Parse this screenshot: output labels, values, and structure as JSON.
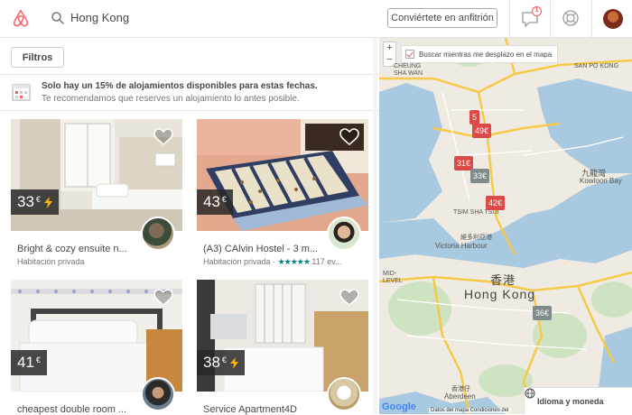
{
  "header": {
    "search_value": "Hong Kong",
    "host_button": "Conviértete en anfitrión",
    "message_badge": "1"
  },
  "filters": {
    "label": "Filtros"
  },
  "notice": {
    "title": "Solo hay un 15% de alojamientos disponibles para estas fechas.",
    "subtitle": "Te recomendamos que reserves un alojamiento lo antes posible."
  },
  "listings": [
    {
      "price": "33",
      "currency": "€",
      "instant": true,
      "title": "Bright & cozy ensuite n...",
      "subtitle": "Habitación privada",
      "rating": "",
      "reviews": ""
    },
    {
      "price": "43",
      "currency": "€",
      "instant": false,
      "title": "(A3) CAlvin Hostel - 3 m...",
      "subtitle": "Habitación privada ·",
      "rating": "★★★★★",
      "reviews": "117 ev..."
    },
    {
      "price": "41",
      "currency": "€",
      "instant": false,
      "title": "cheapest double room ...",
      "subtitle": "",
      "rating": "",
      "reviews": ""
    },
    {
      "price": "38",
      "currency": "€",
      "instant": true,
      "title": "Service Apartment4D",
      "subtitle": "",
      "rating": "",
      "reviews": ""
    }
  ],
  "map": {
    "search_while_moving": "Buscar mientras me desplazo en el mapa",
    "zoom_in": "+",
    "zoom_out": "−",
    "city_label": "Hong Kong",
    "city_label_cn": "香港",
    "places": {
      "cheung_sha_wan": "CHEUNG\nSHA WAN",
      "san_po_kong": "SAN PO KONG",
      "kowloon_bay_cn": "九龍灣",
      "kowloon_bay": "Kowloon Bay",
      "victoria_cn": "維多利亞港",
      "victoria": "Victoria Harbour",
      "tsim_sha_tsui": "TSIM SHA TSUI",
      "aberdeen": "Aberdeen",
      "aberdeen_cn": "香港仔",
      "mid_levels": "MID-\nLEVEL"
    },
    "pins": [
      {
        "label": "5",
        "color": "red"
      },
      {
        "label": "49€",
        "color": "red"
      },
      {
        "label": "31€",
        "color": "red"
      },
      {
        "label": "33€",
        "color": "gray"
      },
      {
        "label": "42€",
        "color": "red"
      },
      {
        "label": "36€",
        "color": "gray"
      }
    ],
    "attribution": "Datos del mapa   Condiciones del",
    "google": "Google",
    "language_button": "Idioma y moneda"
  }
}
